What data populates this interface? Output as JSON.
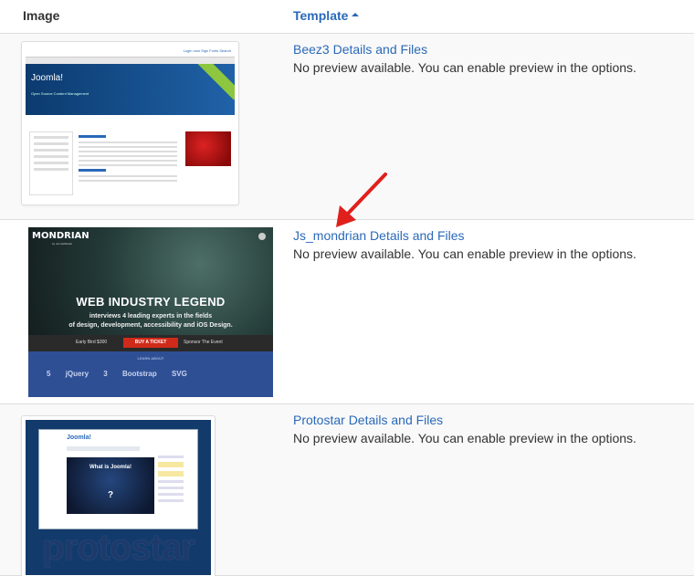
{
  "table": {
    "headers": {
      "image": "Image",
      "template": "Template"
    },
    "sort": {
      "column": "template",
      "direction": "ascending"
    },
    "rows": [
      {
        "link": "Beez3 Details and Files",
        "message": "No preview available. You can enable preview in the options.",
        "thumbnail": {
          "logo": "Joomla!",
          "tagline": "Open Source Content Management",
          "top_links": "Login now   Sign   Fonts   Search"
        }
      },
      {
        "link": "Js_mondrian Details and Files",
        "message": "No preview available. You can enable preview in the options.",
        "thumbnail": {
          "brand": "MONDRIAN",
          "brand_sub": "by JoomlaShack",
          "headline": "WEB INDUSTRY LEGEND",
          "line1": "interviews 4 leading experts in the fields",
          "line2": "of design, development, accessibility and iOS Design.",
          "early_bird": "Early Bird $300",
          "ticket_button": "BUY A TICKET",
          "sponsor": "Sponsor The Event",
          "learn": "LEARN ABOUT",
          "techs": [
            "5",
            "jQuery",
            "3",
            "Bootstrap",
            "SVG"
          ]
        }
      },
      {
        "link": "Protostar Details and Files",
        "message": "No preview available. You can enable preview in the options.",
        "thumbnail": {
          "logo": "Joomla!",
          "video_title": "What is Joomla!",
          "question": "?",
          "word": "protostar"
        }
      }
    ]
  },
  "annotation": {
    "arrow_color": "#e0201c",
    "icon": "arrow-pointer-icon"
  },
  "colors": {
    "link": "#2a69b8",
    "row_alt": "#f9f9f9",
    "border": "#dddddd"
  }
}
